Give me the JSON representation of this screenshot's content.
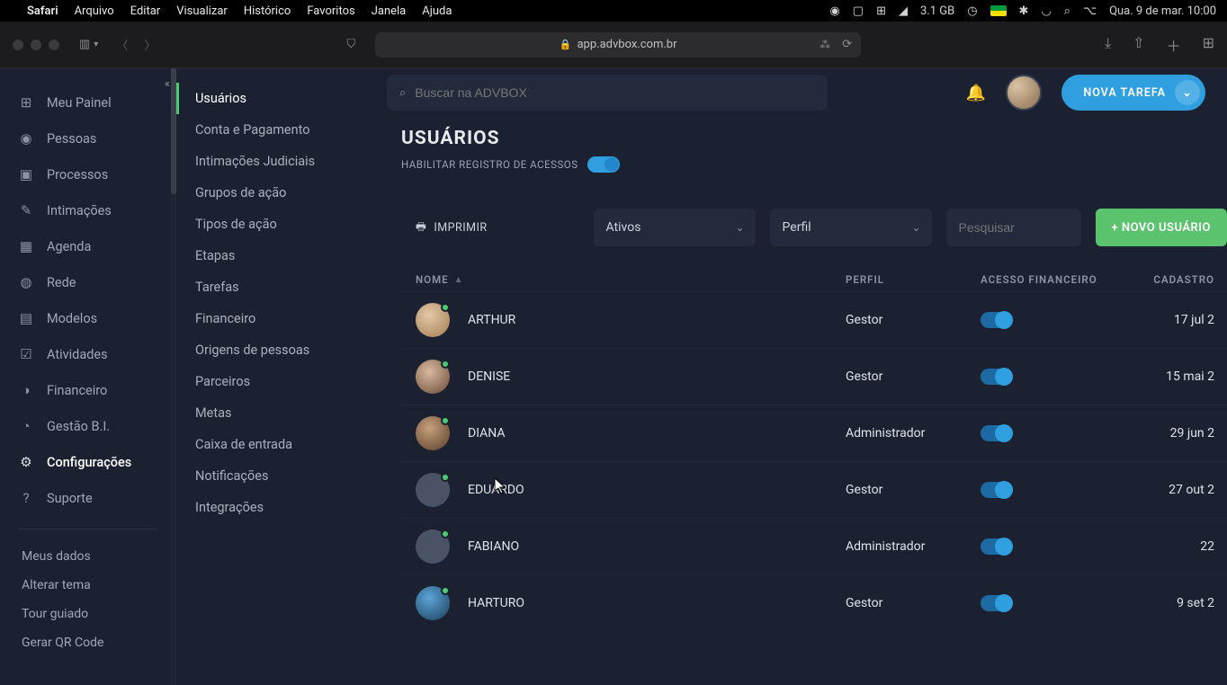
{
  "menubar": {
    "appname": "Safari",
    "items": [
      "Arquivo",
      "Editar",
      "Visualizar",
      "Histórico",
      "Favoritos",
      "Janela",
      "Ajuda"
    ],
    "memory": "3.1 GB",
    "datetime": "Qua. 9 de mar.  10:00"
  },
  "browser": {
    "url": "app.advbox.com.br"
  },
  "topbar": {
    "search_placeholder": "Buscar na ADVBOX",
    "new_task": "NOVA TAREFA"
  },
  "sidebar_main": [
    {
      "icon": "⊞",
      "label": "Meu Painel"
    },
    {
      "icon": "◉",
      "label": "Pessoas"
    },
    {
      "icon": "▣",
      "label": "Processos"
    },
    {
      "icon": "✎",
      "label": "Intimações"
    },
    {
      "icon": "▦",
      "label": "Agenda"
    },
    {
      "icon": "◍",
      "label": "Rede"
    },
    {
      "icon": "▤",
      "label": "Modelos"
    },
    {
      "icon": "☑",
      "label": "Atividades"
    },
    {
      "icon": "◑",
      "label": "Financeiro"
    },
    {
      "icon": "◔",
      "label": "Gestão B.I."
    },
    {
      "icon": "⚙",
      "label": "Configurações",
      "active": true
    },
    {
      "icon": "?",
      "label": "Suporte"
    }
  ],
  "sidebar_extra": [
    "Meus dados",
    "Alterar tema",
    "Tour guiado",
    "Gerar QR Code"
  ],
  "sidebar_secondary": [
    {
      "label": "Usuários",
      "active": true
    },
    {
      "label": "Conta e Pagamento"
    },
    {
      "label": "Intimações Judiciais"
    },
    {
      "label": "Grupos de ação"
    },
    {
      "label": "Tipos de ação"
    },
    {
      "label": "Etapas"
    },
    {
      "label": "Tarefas"
    },
    {
      "label": "Financeiro"
    },
    {
      "label": "Origens de pessoas"
    },
    {
      "label": "Parceiros"
    },
    {
      "label": "Metas"
    },
    {
      "label": "Caixa de entrada"
    },
    {
      "label": "Notificações"
    },
    {
      "label": "Integrações"
    }
  ],
  "page": {
    "title": "USUÁRIOS",
    "access_toggle_label": "HABILITAR REGISTRO DE ACESSOS",
    "print": "IMPRIMIR",
    "filter_status": "Ativos",
    "filter_profile": "Perfil",
    "search_placeholder": "Pesquisar",
    "new_user": "+ NOVO USUÁRIO"
  },
  "columns": {
    "name": "NOME",
    "profile": "PERFIL",
    "finance": "ACESSO FINANCEIRO",
    "created": "CADASTRO"
  },
  "users": [
    {
      "name": "ARTHUR",
      "profile": "Gestor",
      "created": "17 jul 2",
      "av": "c1"
    },
    {
      "name": "DENISE",
      "profile": "Gestor",
      "created": "15 mai 2",
      "av": "c2"
    },
    {
      "name": "DIANA",
      "profile": "Administrador",
      "created": "29 jun 2",
      "av": "c3"
    },
    {
      "name": "EDUARDO",
      "profile": "Gestor",
      "created": "27 out 2",
      "av": "c4"
    },
    {
      "name": "FABIANO",
      "profile": "Administrador",
      "created": "22",
      "av": "c5"
    },
    {
      "name": "HARTURO",
      "profile": "Gestor",
      "created": "9 set 2",
      "av": "c6"
    }
  ]
}
